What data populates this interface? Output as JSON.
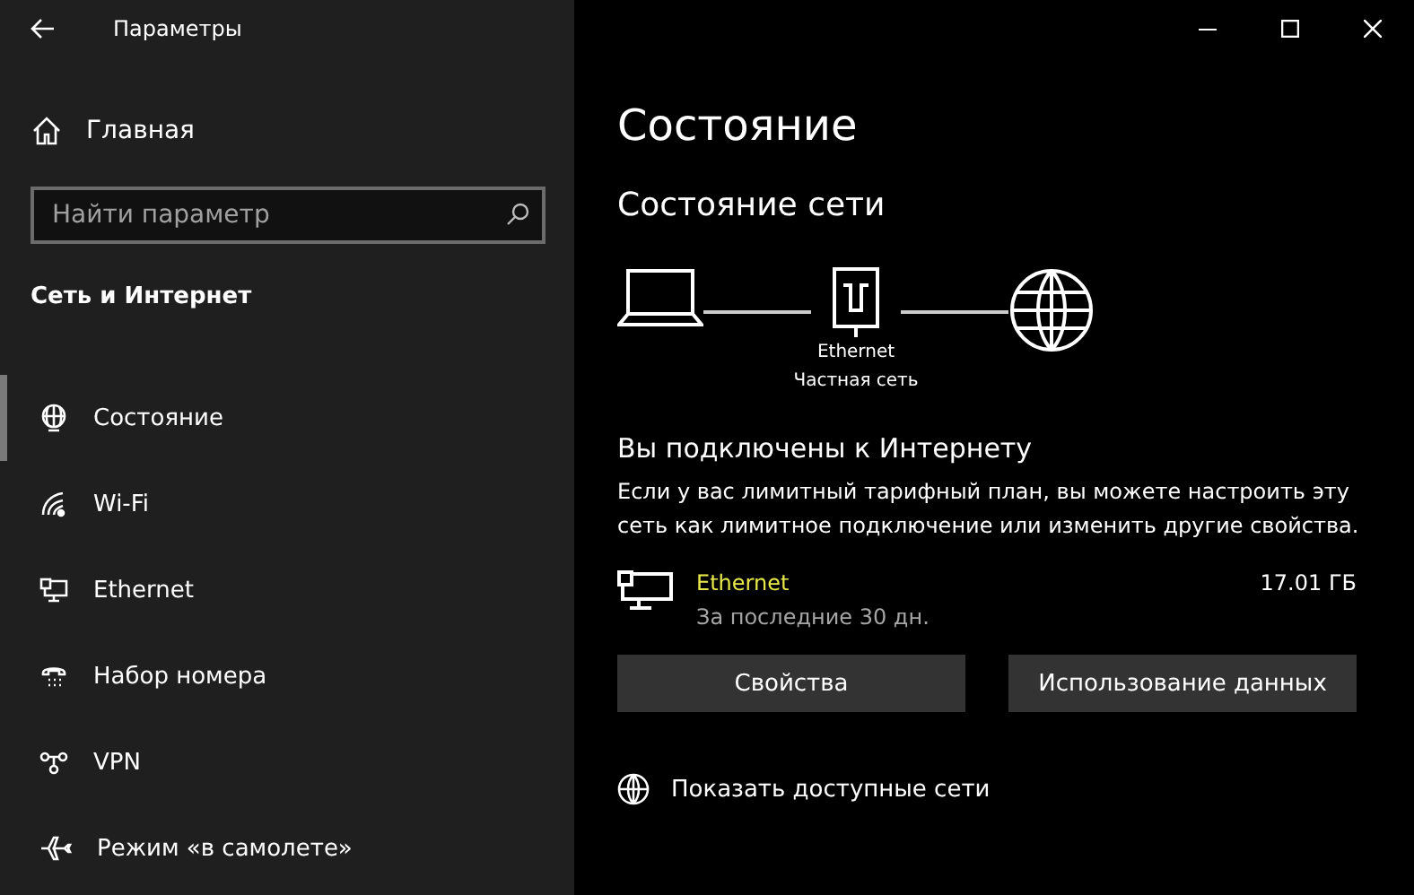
{
  "window": {
    "title": "Параметры"
  },
  "sidebar": {
    "home": "Главная",
    "search": {
      "placeholder": "Найти параметр"
    },
    "section": "Сеть и Интернет",
    "items": [
      {
        "label": "Состояние",
        "kind": "status",
        "selected": true
      },
      {
        "label": "Wi-Fi",
        "kind": "wifi",
        "selected": false
      },
      {
        "label": "Ethernet",
        "kind": "ethernet",
        "selected": false
      },
      {
        "label": "Набор номера",
        "kind": "dialup",
        "selected": false
      },
      {
        "label": "VPN",
        "kind": "vpn",
        "selected": false
      },
      {
        "label": "Режим «в самолете»",
        "kind": "airplane",
        "selected": false
      }
    ]
  },
  "main": {
    "title": "Состояние",
    "subtitle": "Состояние сети",
    "diagram": {
      "adapter": "Ethernet",
      "profile": "Частная сеть"
    },
    "connected": "Вы подключены к Интернету",
    "description": "Если у вас лимитный тарифный план, вы можете настроить эту сеть как лимитное подключение или изменить другие свойства.",
    "connection": {
      "name": "Ethernet",
      "period": "За последние 30 дн.",
      "usage": "17.01 ГБ"
    },
    "buttons": [
      "Свойства",
      "Использование данных"
    ],
    "link": "Показать доступные сети"
  }
}
